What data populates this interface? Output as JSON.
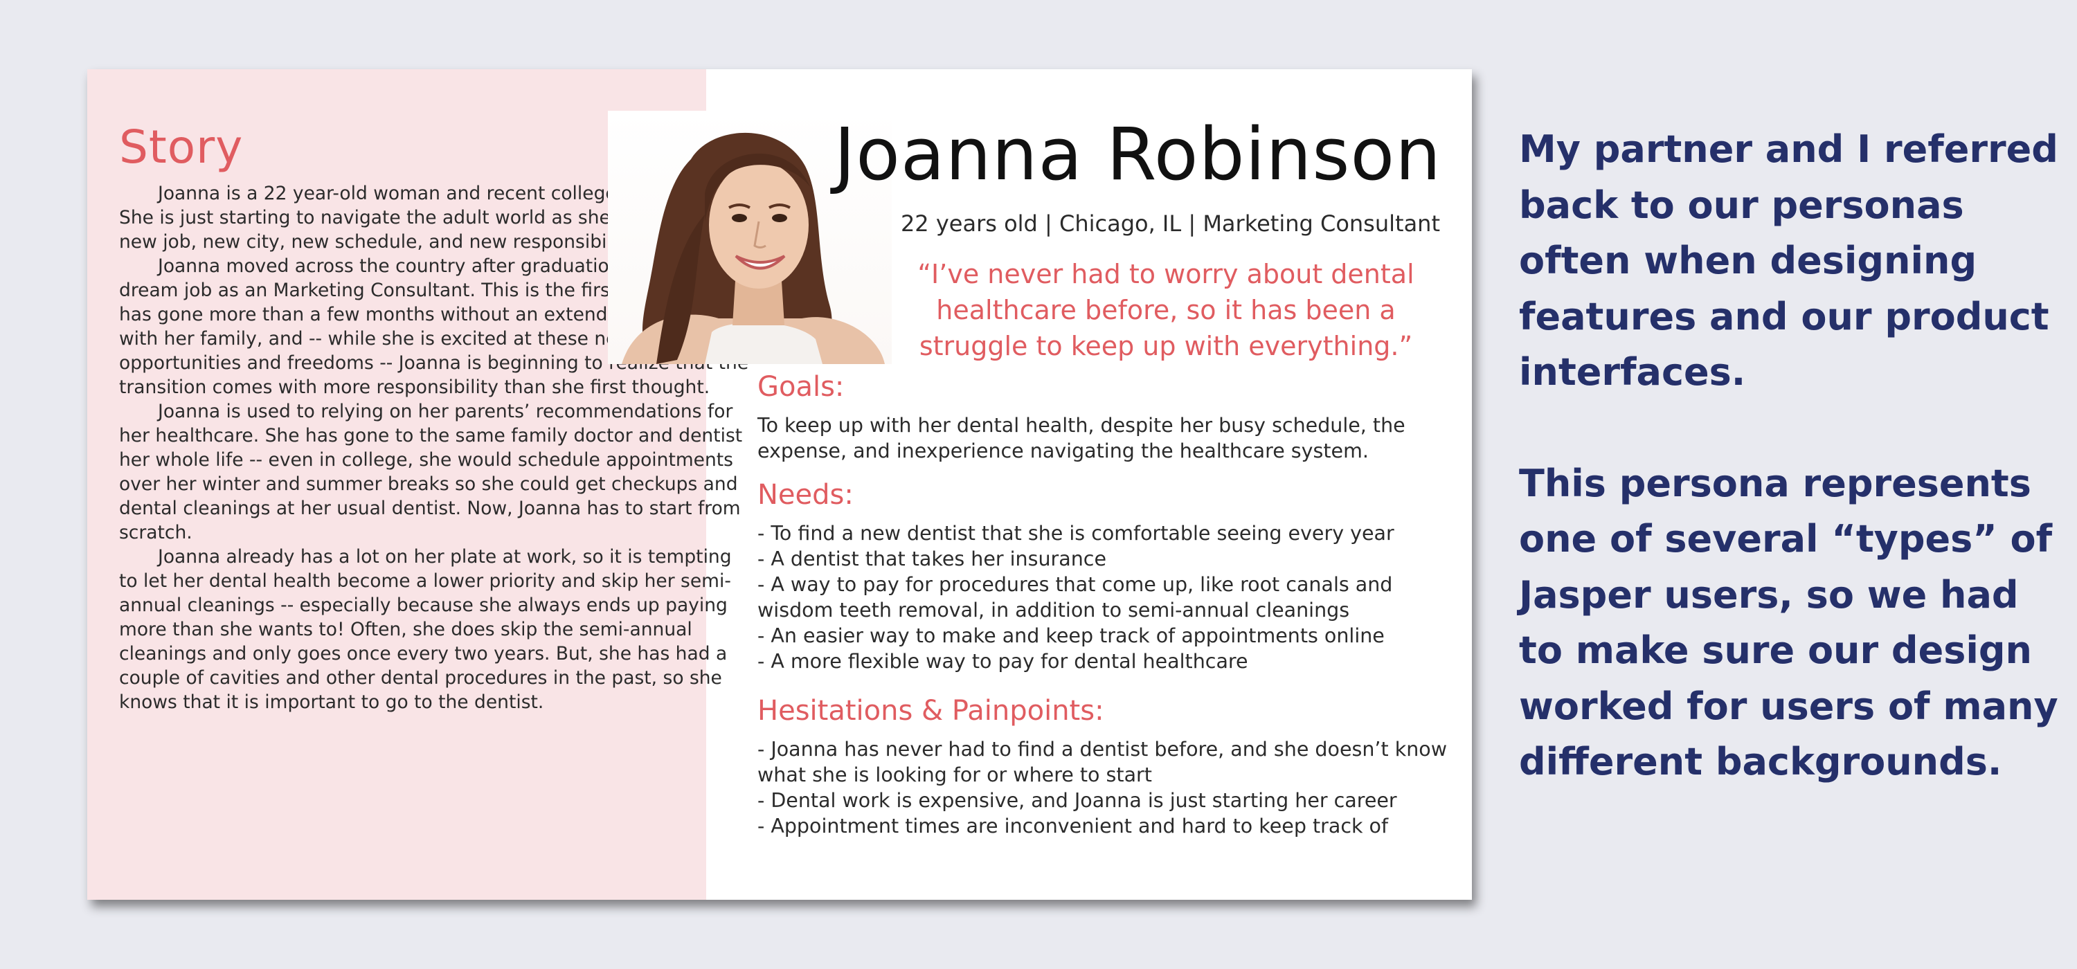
{
  "persona": {
    "name": "Joanna Robinson",
    "meta": "22 years old | Chicago, IL | Marketing Consultant",
    "quote": "“I’ve never had to worry about dental healthcare before, so it has been a struggle to keep up with everything.”"
  },
  "story": {
    "title": "Story",
    "paragraphs": [
      "Joanna is a 22 year-old woman and recent college graduate.  She is just starting to navigate the adult world as she adjusts to her new job, new city, new schedule, and new responsibilities.",
      "Joanna moved across the country after graduation to start her dream job as an Marketing Consultant.  This is the first time Joanna has gone more than a few months without an extended visit home with her family, and -- while she is excited at these new opportunities and freedoms -- Joanna is beginning to realize that the transition comes with more responsibility than she first thought.",
      "Joanna is used to relying on her parents’ recommendations for her healthcare.  She has gone to the same family doctor and dentist her whole life -- even in college, she would schedule appointments over her winter and summer breaks so she could get checkups and dental cleanings at her usual dentist.  Now, Joanna has to start from scratch.",
      "Joanna already has a lot on her plate at work, so it is tempting to let her dental health become a lower priority and skip her semi-annual cleanings -- especially because she always ends up paying more than she wants to!  Often, she does skip the semi-annual cleanings and only goes once every two years.  But, she has had a couple of cavities and other dental procedures in the past, so she knows that it is important to go to the dentist."
    ]
  },
  "goals": {
    "title": "Goals:",
    "text": "To keep up with her dental health, despite her busy schedule, the expense, and inexperience navigating the healthcare system."
  },
  "needs": {
    "title": "Needs:",
    "items": [
      "- To find a new dentist that she is comfortable seeing every year",
      "- A dentist that takes her insurance",
      "- A way to pay for procedures that come up, like root canals and wisdom teeth removal, in addition to semi-annual cleanings",
      "- An easier way to make and keep track of appointments online",
      "- A more flexible way to pay for dental healthcare"
    ]
  },
  "hesitations": {
    "title": "Hesitations & Painpoints:",
    "items": [
      "- Joanna has never had to find a dentist before, and she doesn’t know what she is looking for or where to start",
      "- Dental work is expensive, and Joanna is just starting her career",
      "- Appointment times are inconvenient and hard to keep track of"
    ]
  },
  "side_note": {
    "paragraph1": "My partner and I referred back to our personas often when designing features and our product interfaces.",
    "paragraph2": "This persona represents one of several “types” of Jasper users, so we had to make sure our design worked for users of many different backgrounds."
  },
  "colors": {
    "accent": "#e05c60",
    "story_bg": "#f9e4e6",
    "side_text": "#25306a",
    "page_bg": "#e9eaf0"
  }
}
